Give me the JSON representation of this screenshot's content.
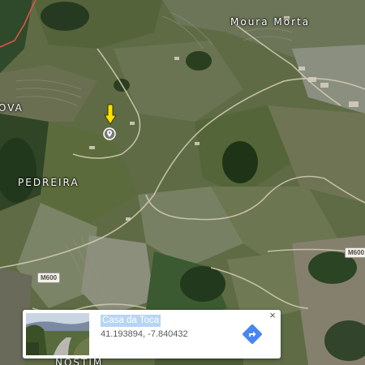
{
  "map": {
    "type": "satellite",
    "place_labels": [
      {
        "id": "moura-morta",
        "text": "Moura Morta"
      },
      {
        "id": "ova",
        "text": "OVA"
      },
      {
        "id": "pedreira",
        "text": "PEDREIRA"
      },
      {
        "id": "nostim",
        "text": "NOSTIM"
      }
    ],
    "road_shields": [
      {
        "id": "m600-left",
        "text": "M600"
      },
      {
        "id": "m600-right",
        "text": "M600"
      }
    ],
    "marker": {
      "icon": "location-pin-icon",
      "highlight": "yellow-down-arrow-icon",
      "highlight_color": "#ffe000"
    }
  },
  "place_card": {
    "title": "Casa da Toca",
    "coordinates": "41.193894, -7.840432",
    "title_highlight_color": "#b7d4f5",
    "directions_icon": "directions-icon",
    "directions_color": "#4a86f2",
    "close_icon": "close-icon",
    "close_symbol": "×"
  }
}
